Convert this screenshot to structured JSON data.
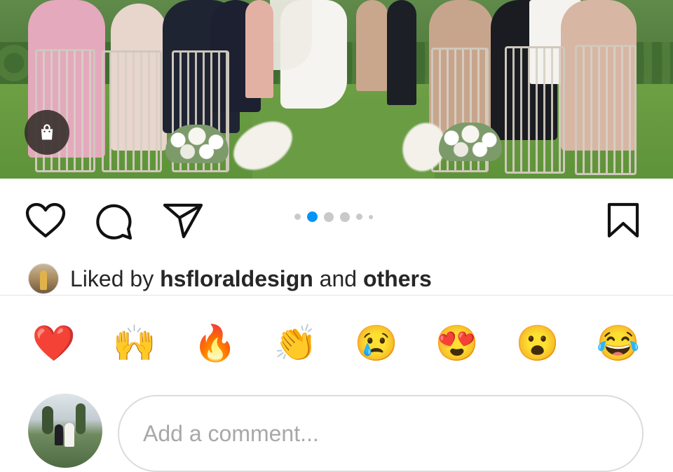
{
  "post": {
    "carousel": {
      "total": 6,
      "active_index": 1
    },
    "shopping_icon": "shopping-bag-icon"
  },
  "actions": {
    "like_icon": "heart-icon",
    "comment_icon": "comment-icon",
    "share_icon": "paper-plane-icon",
    "save_icon": "bookmark-icon"
  },
  "likes": {
    "prefix": "Liked by",
    "user": "hsfloraldesign",
    "connector": "and",
    "others": "others"
  },
  "reactions": [
    {
      "name": "red-heart",
      "glyph": "❤️"
    },
    {
      "name": "raising-hands",
      "glyph": "🙌"
    },
    {
      "name": "fire",
      "glyph": "🔥"
    },
    {
      "name": "clapping-hands",
      "glyph": "👏"
    },
    {
      "name": "crying-face",
      "glyph": "😢"
    },
    {
      "name": "heart-eyes",
      "glyph": "😍"
    },
    {
      "name": "astonished-face",
      "glyph": "😮"
    },
    {
      "name": "tears-of-joy",
      "glyph": "😂"
    }
  ],
  "composer": {
    "placeholder": "Add a comment...",
    "value": ""
  },
  "colors": {
    "accent_blue": "#0095f6",
    "text": "#262626",
    "muted": "#a8a8a8"
  }
}
